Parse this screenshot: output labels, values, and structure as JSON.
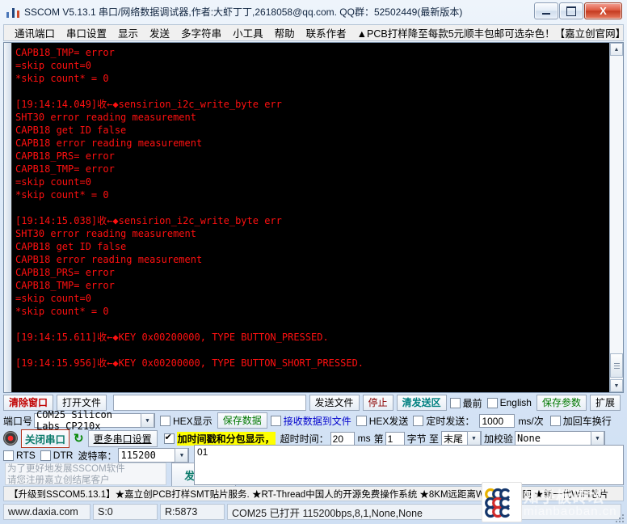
{
  "window": {
    "title": "SSCOM V5.13.1 串口/网络数据调试器,作者:大虾丁丁,2618058@qq.com. QQ群：52502449(最新版本)",
    "minimize_label": "",
    "maximize_label": "",
    "close_label": "X"
  },
  "menu": {
    "items": [
      "通讯端口",
      "串口设置",
      "显示",
      "发送",
      "多字符串",
      "小工具",
      "帮助",
      "联系作者"
    ],
    "ad": "▲PCB打样降至每款5元顺丰包邮可选杂色！【嘉立创官网】"
  },
  "terminal": {
    "lines": [
      "CAPB18_TMP= error",
      "=skip count=0",
      "*skip count* = 0",
      "",
      "[19:14:14.049]收←◆sensirion_i2c_write_byte err",
      "SHT30 error reading measurement",
      "CAPB18 get ID false",
      "CAPB18 error reading measurement",
      "CAPB18_PRS= error",
      "CAPB18_TMP= error",
      "=skip count=0",
      "*skip count* = 0",
      "",
      "[19:14:15.038]收←◆sensirion_i2c_write_byte err",
      "SHT30 error reading measurement",
      "CAPB18 get ID false",
      "CAPB18 error reading measurement",
      "CAPB18_PRS= error",
      "CAPB18_TMP= error",
      "=skip count=0",
      "*skip count* = 0",
      "",
      "[19:14:15.611]收←◆KEY 0x00200000, TYPE BUTTON_PRESSED.",
      "",
      "[19:14:15.956]收←◆KEY 0x00200000, TYPE BUTTON_SHORT_PRESSED."
    ],
    "text_color": "#ff1010",
    "bg_color": "#000000"
  },
  "toolbar_row1": {
    "clear_window": "清除窗口",
    "open_file": "打开文件",
    "file_path": "",
    "send_file": "发送文件",
    "stop": "停止",
    "clear_send_area": "清发送区",
    "topmost": "最前",
    "english": "English",
    "save_params": "保存参数",
    "extend": "扩展",
    "topmost_checked": false,
    "english_checked": false
  },
  "toolbar_row2": {
    "port_label": "端口号",
    "port_value": "COM25 Silicon Labs CP210x ",
    "hex_display": "HEX显示",
    "hex_display_checked": false,
    "save_data": "保存数据",
    "recv_to_file": "接收数据到文件",
    "recv_to_file_checked": false,
    "hex_send": "HEX发送",
    "hex_send_checked": false,
    "timed_send": "定时发送：",
    "timed_send_checked": false,
    "timed_send_value": "1000",
    "ms_per": "ms/次",
    "add_crlf": "加回车换行",
    "add_crlf_checked": false
  },
  "toolbar_row3": {
    "close_port": "关闭串口",
    "more_settings": "更多串口设置",
    "timestamp_label": "加时间戳和分包显示，",
    "timestamp_checked": true,
    "timeout_label": "超时时间：",
    "timeout_value": "20",
    "ms_unit": "ms",
    "nth_label": "第",
    "nth_value": "1",
    "byte_label": "字节 至",
    "end_value": "末尾",
    "checksum_label": "加校验",
    "checksum_value": "None"
  },
  "toolbar_row4": {
    "rts": "RTS",
    "rts_checked": false,
    "dtr": "DTR",
    "dtr_checked": false,
    "baud_label": "波特率：",
    "baud_value": "115200"
  },
  "send_area": {
    "ad_line1": "为了更好地发展SSCOM软件",
    "ad_line2": "请您注册嘉立创结尾客户",
    "send_button": "发 送",
    "text_value": "01"
  },
  "ad_strip": "【升级到SSCOM5.13.1】★嘉立创PCB打样SMT贴片服务. ★RT-Thread中国人的开源免费操作系统 ★8KM远距离WiFi可自组网 ★新一代WiFi芯片",
  "status_bar": {
    "website": "www.daxia.com",
    "sent": "S:0",
    "received": "R:5873",
    "connection": "COM25 已打开  115200bps,8,1,None,None"
  },
  "watermark": {
    "text": "知乎板砖坛",
    "subtext": "mianbaoban.cn"
  }
}
